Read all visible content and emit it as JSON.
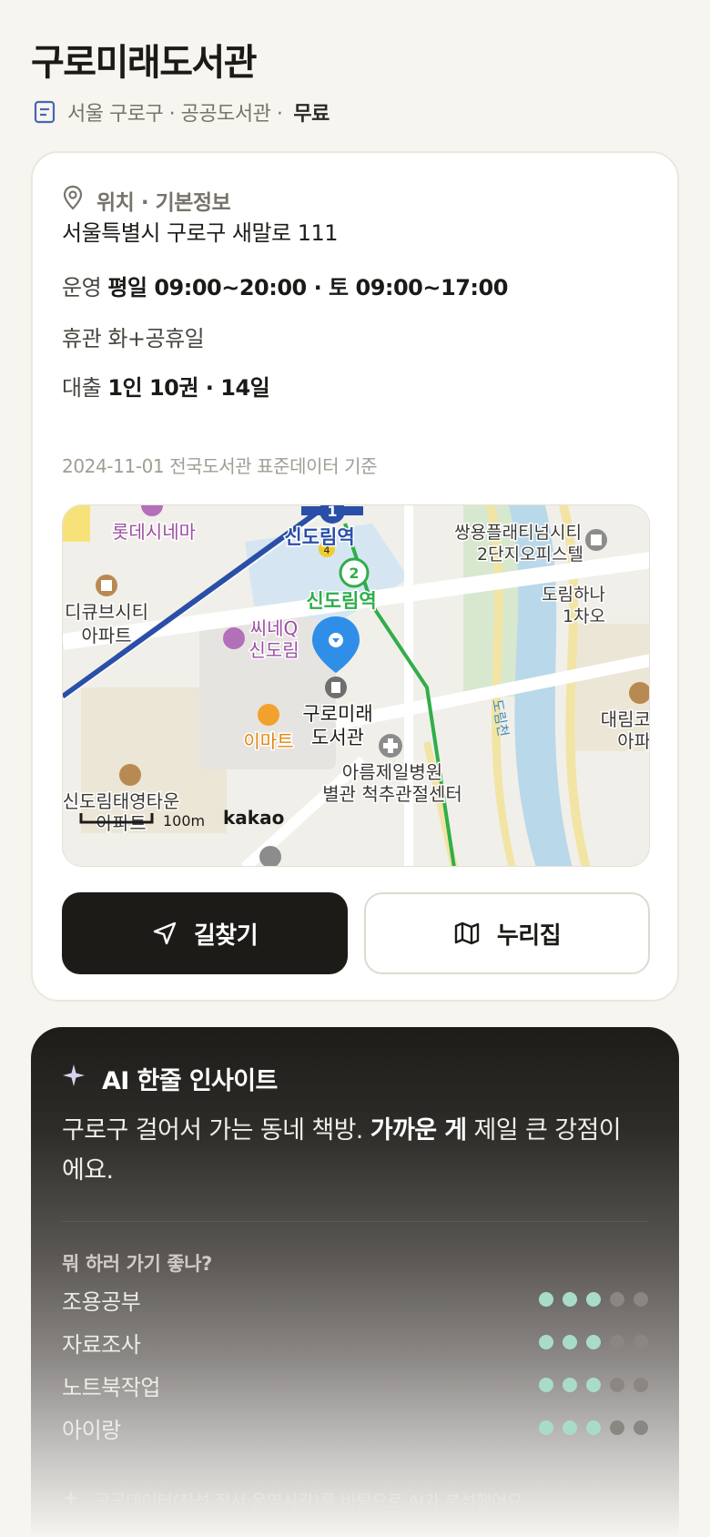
{
  "header": {
    "title": "구로미래도서관",
    "meta": "서울 구로구 · 공공도서관 ·",
    "fee": "무료"
  },
  "info": {
    "section_title": "위치 · 기본정보",
    "address": "서울특별시 구로구 새말로 111",
    "hours_label": "운영",
    "hours_value": "평일 09:00~20:00 · 토 09:00~17:00",
    "closed_label": "휴관",
    "closed_value": "화+공휴일",
    "loan_label": "대출",
    "loan_value": "1인 10권 · 14일",
    "source": "2024-11-01 전국도서관 표준데이터 기준"
  },
  "map": {
    "labels": {
      "lotte_cinema": "롯데시네마",
      "sindorim_station_1": "신도림역",
      "sindorim_station_2": "신도림역",
      "line1_badge": "1",
      "line2_badge": "2",
      "line4_badge": "4",
      "ssangyong_1": "쌍용플래티넘시티",
      "ssangyong_2": "2단지오피스텔",
      "dorim_hana_1": "도림하나",
      "dorim_hana_2": "1차오",
      "dcube_1": "디큐브시티",
      "dcube_2": "아파트",
      "cineq_1": "씨네Q",
      "cineq_2": "신도림",
      "library_1": "구로미래",
      "library_2": "도서관",
      "emart": "이마트",
      "hospital_1": "아름제일병원",
      "hospital_2": "별관 척추관절센터",
      "daerim_1": "대림코",
      "daerim_2": "아파",
      "dorimcheon": "도림천",
      "taeyoung_1": "신도림태영타운",
      "taeyoung_2": "아파트",
      "scale": "100m",
      "provider": "kakao"
    }
  },
  "actions": {
    "route_label": "길찾기",
    "website_label": "누리집"
  },
  "ai": {
    "title": "AI 한줄 인사이트",
    "summary_pre": "구로구 걸어서 가는 동네 책방. ",
    "summary_bold": "가까운 게",
    "summary_post": " 제일 큰 강점이에요.",
    "question": "뭐 하러 가기 좋나?",
    "ratings": [
      {
        "label": "조용공부",
        "score": 3,
        "max": 5
      },
      {
        "label": "자료조사",
        "score": 3,
        "max": 5
      },
      {
        "label": "노트북작업",
        "score": 3,
        "max": 5
      },
      {
        "label": "아이랑",
        "score": 3,
        "max": 5
      }
    ],
    "footnote": "공공데이터(좌석·장서·운영시간)를 바탕으로 AI가 분석했어요"
  },
  "colors": {
    "background": "#f7f5ef",
    "primary_button": "#1d1b18",
    "rating_on": "#a9dcc8",
    "map_pin": "#2f8fe8",
    "line1": "#2a4fa8",
    "line2": "#2fae4a"
  }
}
